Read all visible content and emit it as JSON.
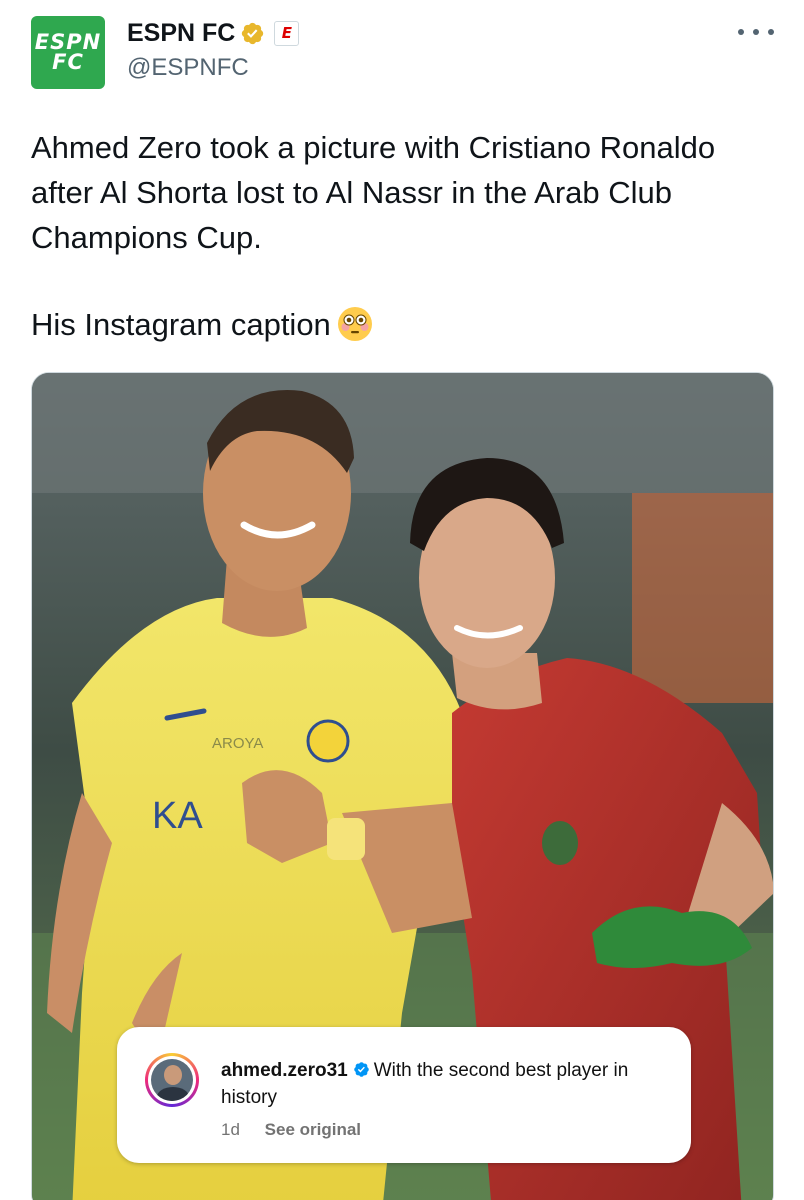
{
  "author": {
    "logo_line1": "ESPN",
    "logo_line2": "FC",
    "display_name": "ESPN FC",
    "handle": "@ESPNFC",
    "affiliate_badge": "E",
    "verified_color": "#e8b72c"
  },
  "icons": {
    "more": "more-horizontal-icon",
    "verified": "verified-badge-icon",
    "emoji": "flushed-face-emoji"
  },
  "tweet": {
    "text_line1": "Ahmed Zero took a picture with Cristiano Ronaldo after Al Shorta lost to Al Nassr in the Arab Club Champions Cup.",
    "text_line2": "His Instagram caption"
  },
  "media": {
    "jersey_left": "AROYA",
    "caption": {
      "username": "ahmed.zero31",
      "text": "With the second best player in history",
      "time": "1d",
      "see_original": "See original"
    }
  }
}
